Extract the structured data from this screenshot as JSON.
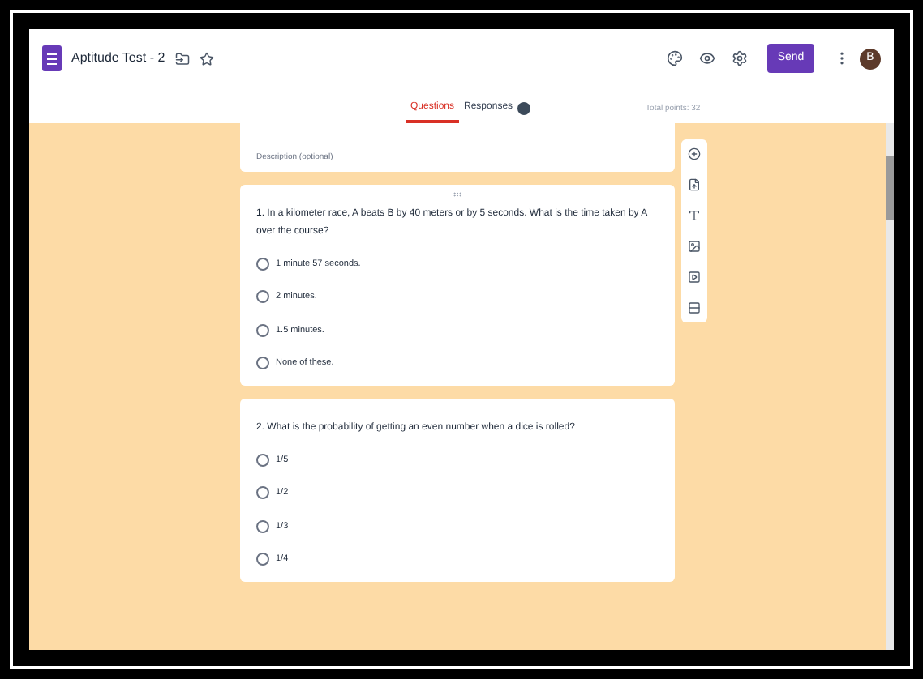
{
  "header": {
    "title": "Aptitude Test - 2",
    "send": "Send",
    "avatar": "B"
  },
  "tabs": [
    {
      "label": "Questions",
      "selected": true
    },
    {
      "label": "Responses",
      "selected": false
    }
  ],
  "total_points": "Total points: 32",
  "description": {
    "placeholder": "Description (optional)"
  },
  "questions": [
    {
      "text": "1. In a kilometer race, A beats B by 40 meters or by 5 seconds. What is the time taken by A over the course?",
      "options": [
        "1 minute 57 seconds.",
        "2 minutes.",
        "1.5 minutes.",
        "None of these."
      ]
    },
    {
      "text": "2. What is the probability of getting an even number when a dice is rolled?",
      "options": [
        "1/5",
        "1/2",
        "1/3",
        "1/4"
      ]
    }
  ]
}
